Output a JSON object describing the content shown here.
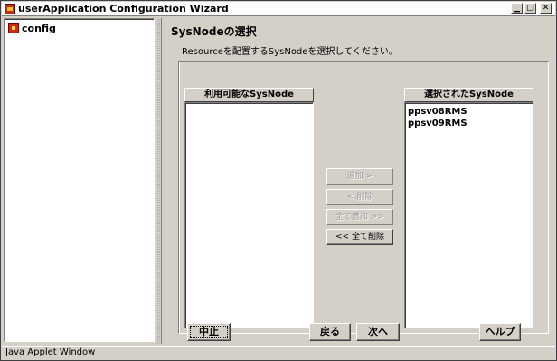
{
  "window": {
    "title": "userApplication Configuration Wizard",
    "app_icon": "wizard-app-icon",
    "controls": {
      "minimize": "▁",
      "maximize": "□",
      "close": "✕"
    }
  },
  "tree": {
    "items": [
      {
        "label": "config",
        "icon": "config-node-icon"
      }
    ]
  },
  "page": {
    "title": "SysNodeの選択",
    "instructions": "Resourceを配置するSysNodeを選択してください。"
  },
  "available_list": {
    "header": "利用可能なSysNode",
    "items": []
  },
  "selected_list": {
    "header": "選択されたSysNode",
    "items": [
      "ppsv08RMS",
      "ppsv09RMS"
    ]
  },
  "transfer_buttons": {
    "add": "追加 >",
    "remove": "< 削除",
    "add_all": "全て追加 >>",
    "remove_all": "<< 全て削除"
  },
  "footer_buttons": {
    "cancel": "中止",
    "back": "戻る",
    "next": "次へ",
    "help": "ヘルプ"
  },
  "statusbar": {
    "text": "Java Applet Window"
  }
}
